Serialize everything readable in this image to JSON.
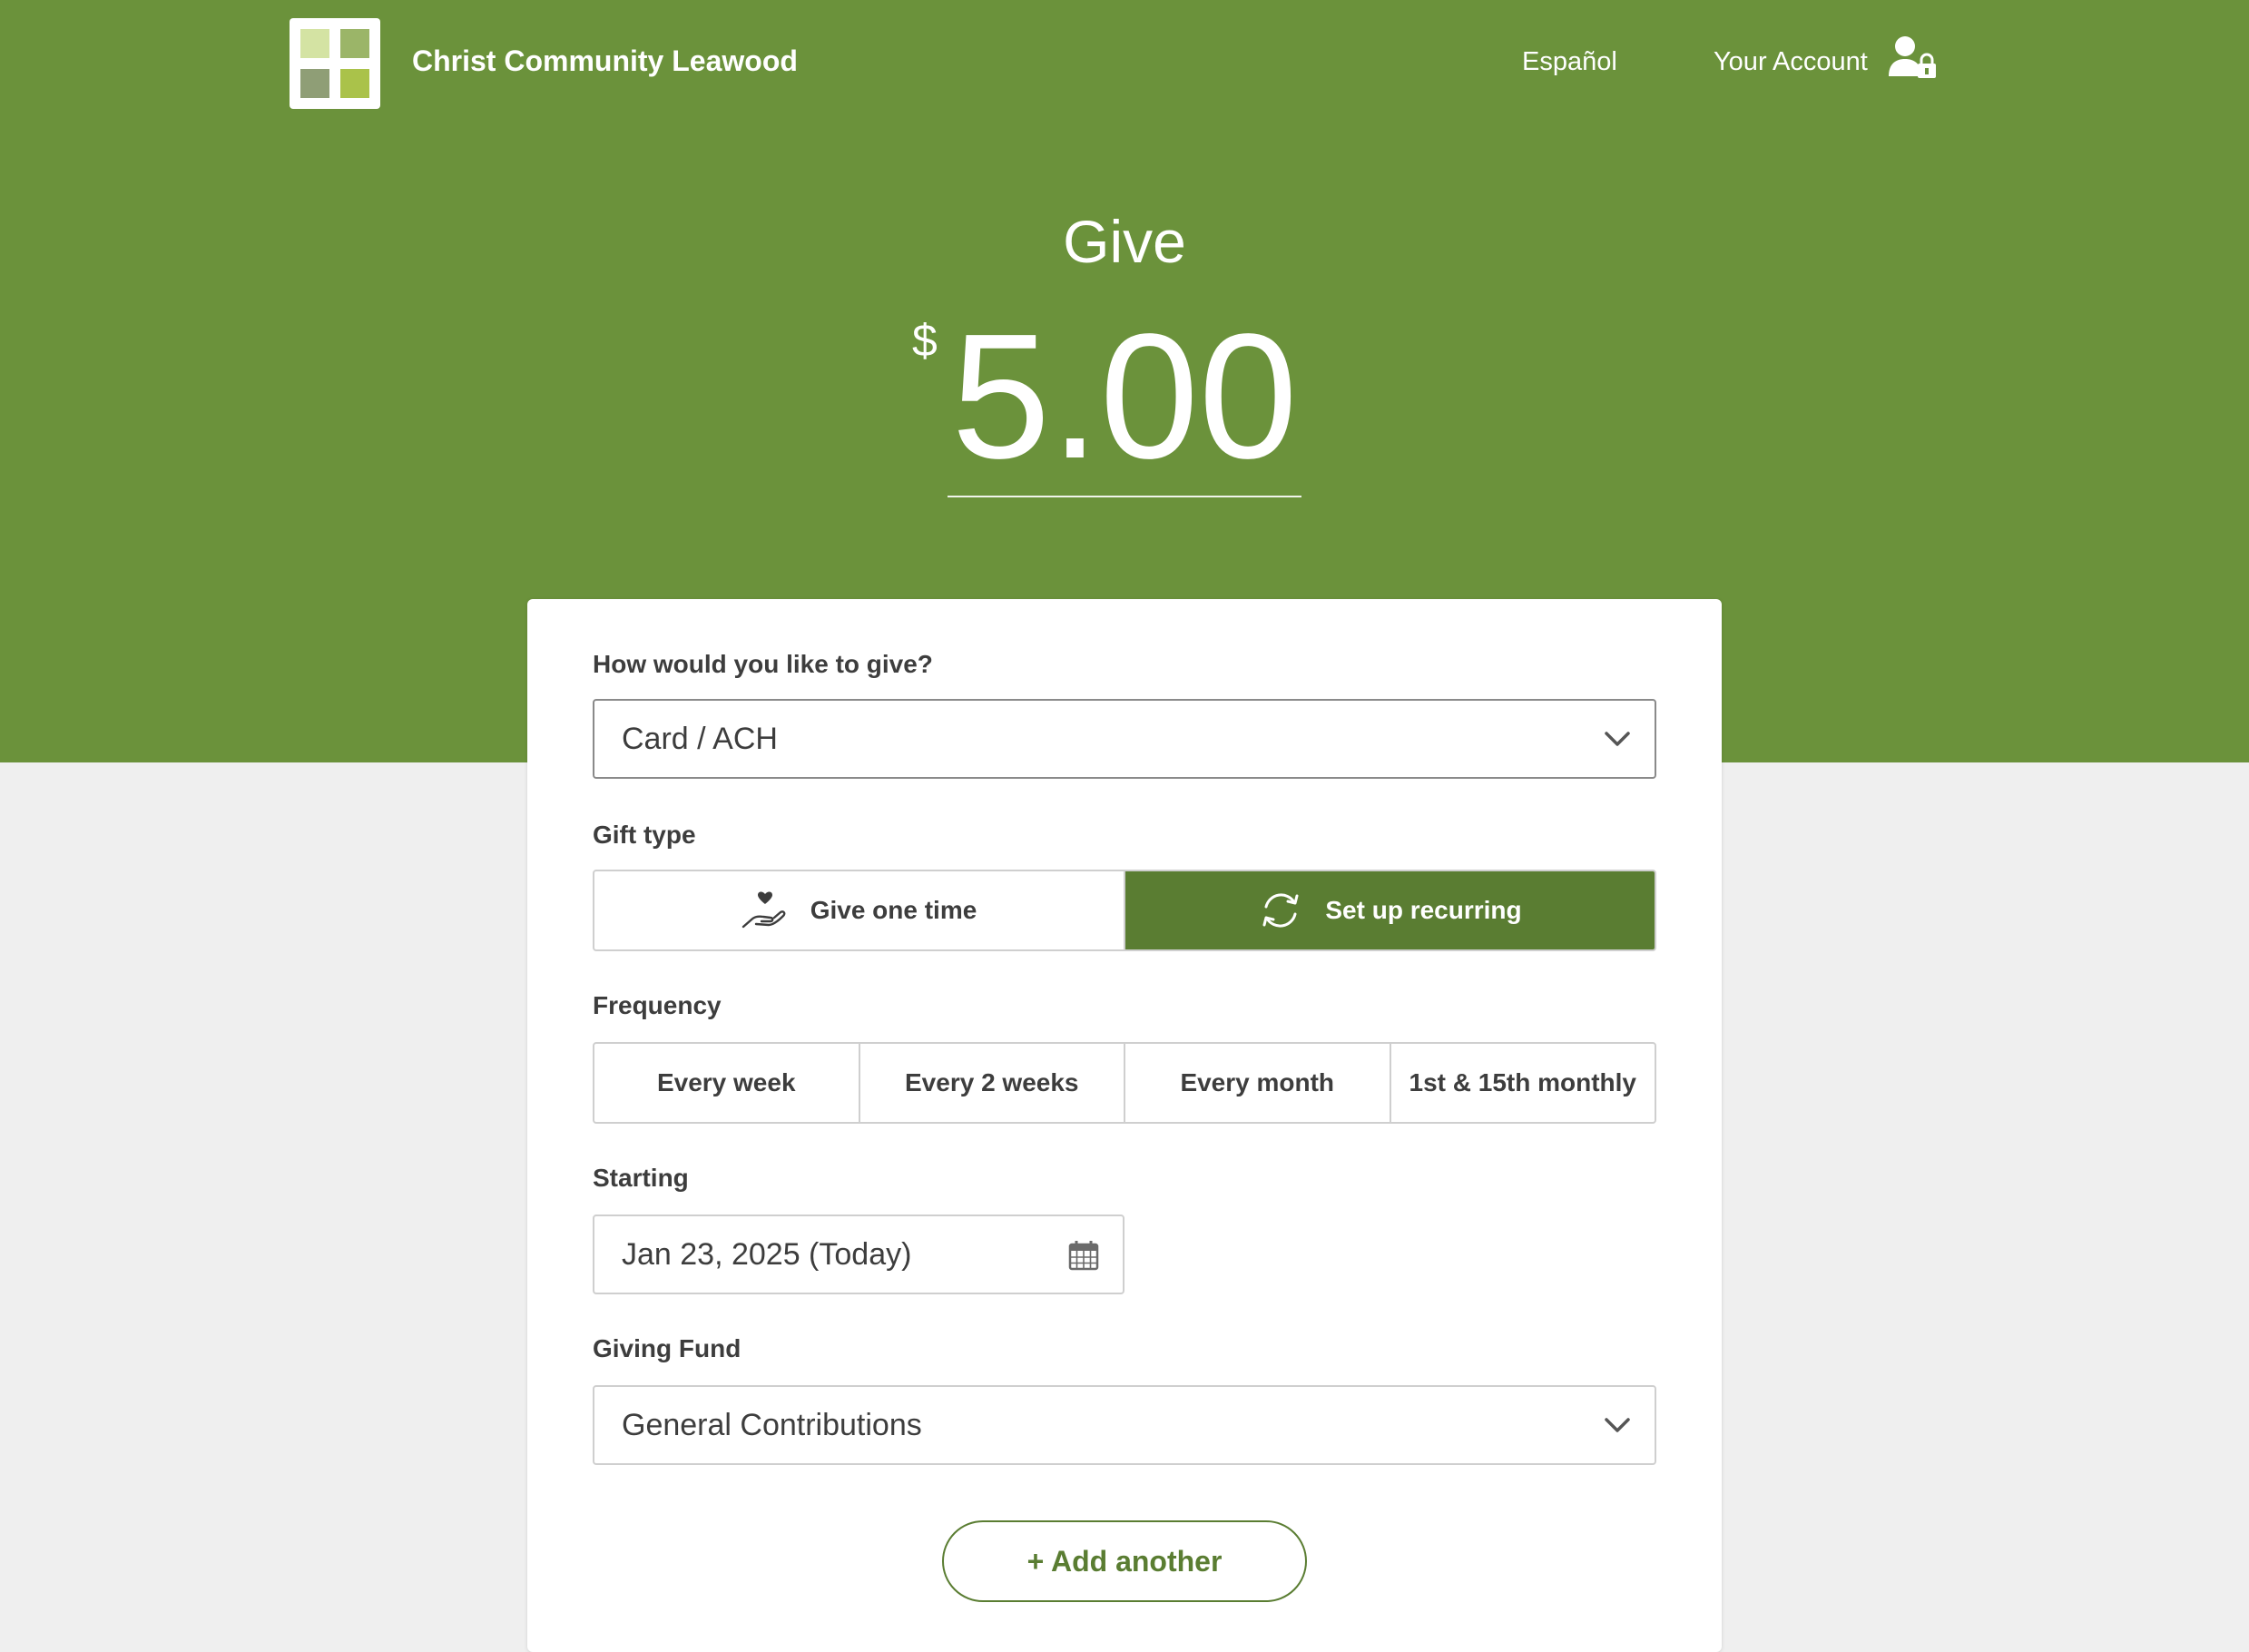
{
  "header": {
    "brand_name": "Christ Community Leawood",
    "language_link": "Español",
    "account_link": "Your Account"
  },
  "give": {
    "title": "Give",
    "currency_symbol": "$",
    "amount": "5.00"
  },
  "form": {
    "method": {
      "label": "How would you like to give?",
      "value": "Card / ACH"
    },
    "gift_type": {
      "label": "Gift type",
      "options": [
        {
          "label": "Give one time",
          "icon": "hand-heart-icon",
          "selected": false
        },
        {
          "label": "Set up recurring",
          "icon": "recurring-arrows-icon",
          "selected": true
        }
      ]
    },
    "frequency": {
      "label": "Frequency",
      "options": [
        "Every week",
        "Every 2 weeks",
        "Every month",
        "1st & 15th monthly"
      ]
    },
    "starting": {
      "label": "Starting",
      "value": "Jan 23, 2025 (Today)"
    },
    "fund": {
      "label": "Giving Fund",
      "value": "General Contributions"
    },
    "add_another_label": "+ Add another"
  },
  "colors": {
    "brand_green": "#6b923b",
    "active_green": "#5a7d32",
    "page_bg": "#efefef"
  }
}
